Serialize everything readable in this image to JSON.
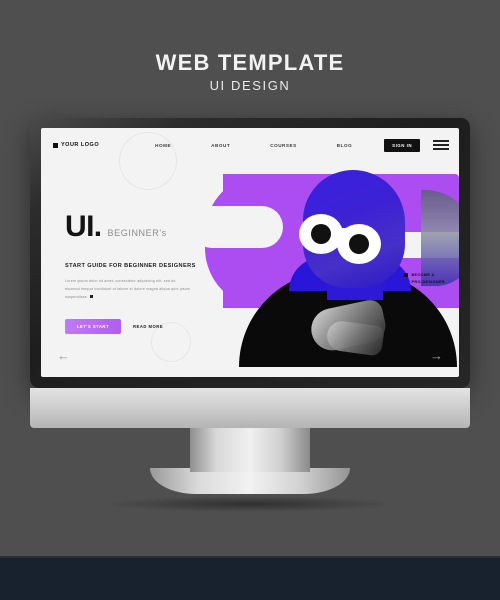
{
  "poster": {
    "title": "WEB TEMPLATE",
    "subtitle": "UI DESIGN",
    "background_color": "#4f4f4f",
    "bottom_strip_color": "#18222f"
  },
  "website": {
    "nav": {
      "logo_text": "YOUR LOGO",
      "links": [
        {
          "label": "HOME"
        },
        {
          "label": "ABOUT"
        },
        {
          "label": "COURSES"
        },
        {
          "label": "BLOG"
        }
      ],
      "signin_label": "SIGN IN",
      "menu_icon": "hamburger-icon"
    },
    "hero": {
      "headline_main": "UI.",
      "headline_sub": "BEGINNER's",
      "subheading": "START GUIDE FOR BEGINNER DESIGNERS",
      "body": "Lorem ipsum dolor sit amet, consectetur adipiscing elit, sed do eiusmod tempor incididunt ut labore et dolore magna aliqua quis ipsum suspendisse",
      "cta_primary": "LET'S START",
      "cta_secondary": "READ MORE",
      "badge_line1": "BECOME A",
      "badge_line2": "PRO-DESIGNER",
      "arrow_prev": "←",
      "arrow_next": "→",
      "accent_color": "#ab4df0",
      "accent_secondary": "#2a16d8"
    }
  }
}
